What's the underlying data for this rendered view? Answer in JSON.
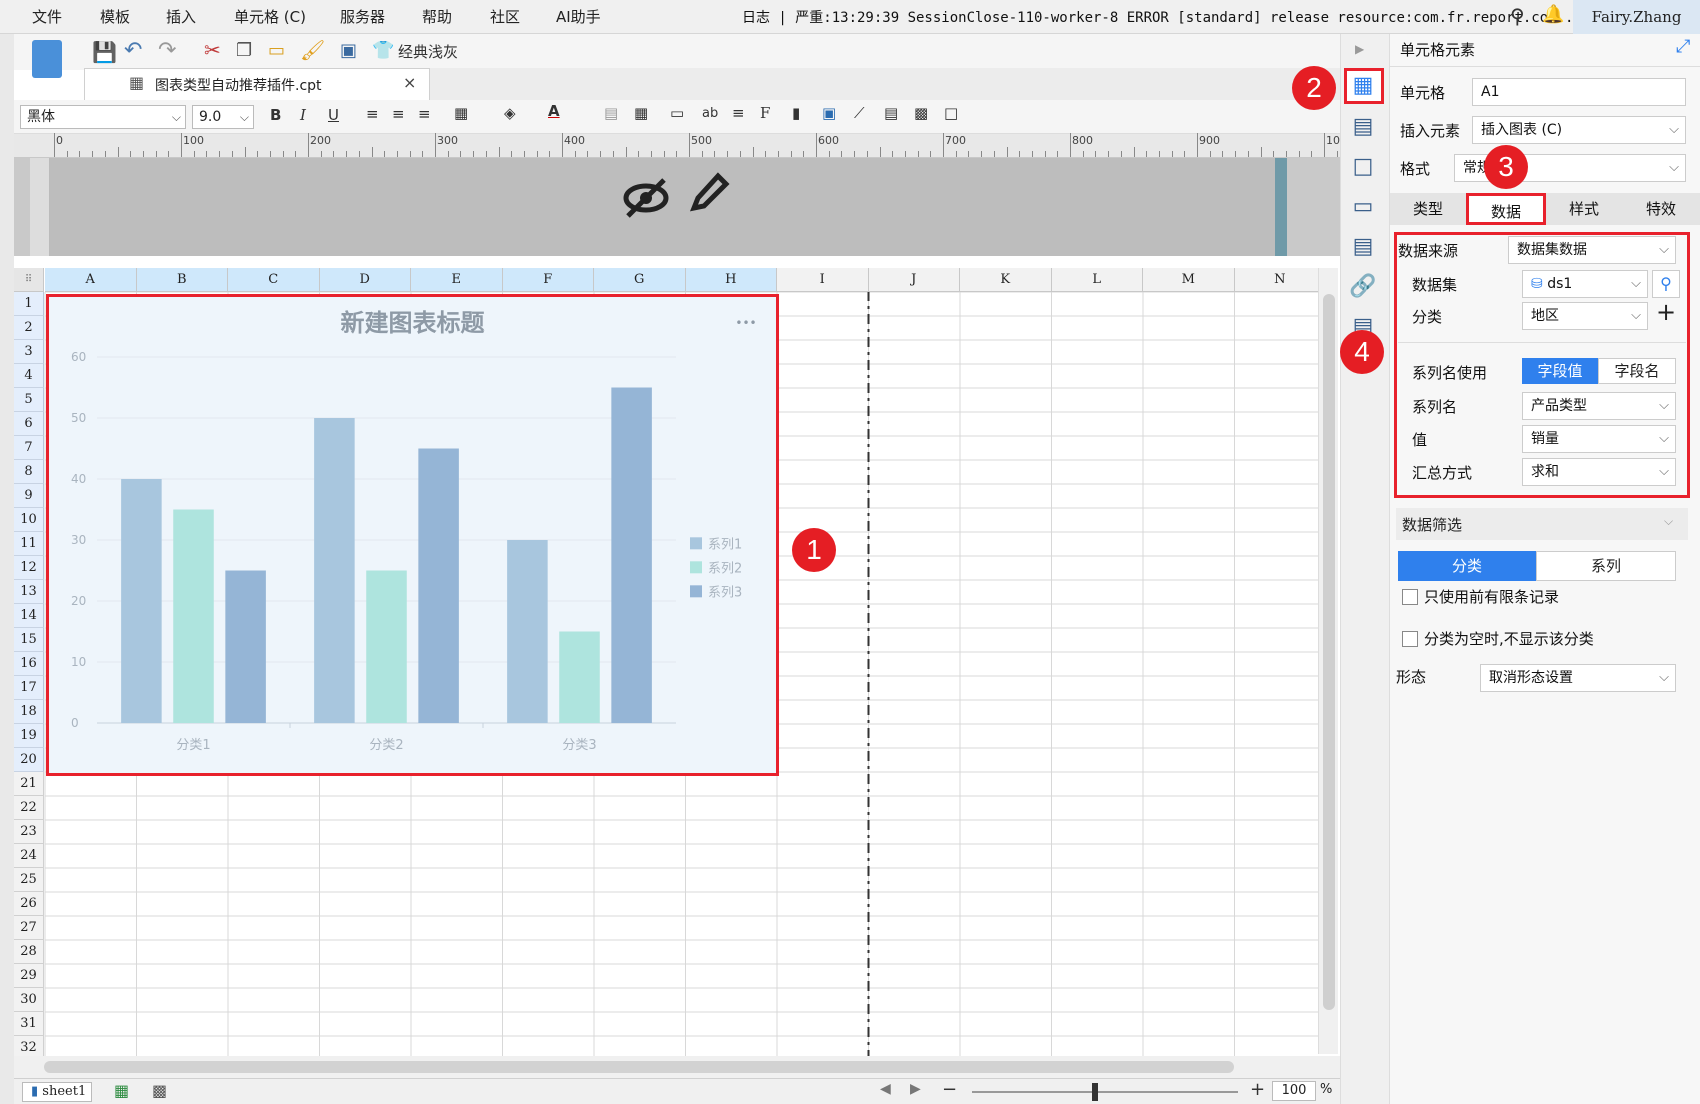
{
  "menubar": {
    "items": [
      "文件",
      "模板",
      "插入",
      "单元格 (C)",
      "服务器",
      "帮助",
      "社区",
      "AI助手"
    ],
    "log": "日志 | 严重:13:29:39 SessionClose-110-worker-8 ERROR [standard] release resource:com.fr.report.co...",
    "user": "Fairy.Zhang"
  },
  "toolbar": {
    "theme_label": "经典浅灰",
    "font": "黑体",
    "size": "9.0"
  },
  "filetab": {
    "name": "图表类型自动推荐插件.cpt",
    "close": "×"
  },
  "ruler": {
    "marks": [
      "0",
      "100",
      "200",
      "300",
      "400",
      "500",
      "600",
      "700",
      "800",
      "900",
      "10"
    ]
  },
  "grid": {
    "columns": [
      "A",
      "B",
      "C",
      "D",
      "E",
      "F",
      "G",
      "H",
      "I",
      "J",
      "K",
      "L",
      "M",
      "N"
    ],
    "rows": [
      "1",
      "2",
      "3",
      "4",
      "5",
      "6",
      "7",
      "8",
      "9",
      "10",
      "11",
      "12",
      "13",
      "14",
      "15",
      "16",
      "17",
      "18",
      "19",
      "20",
      "21",
      "22",
      "23",
      "24",
      "25",
      "26",
      "27",
      "28",
      "29",
      "30",
      "31",
      "32"
    ]
  },
  "chart_data": {
    "type": "bar",
    "title": "新建图表标题",
    "categories": [
      "分类1",
      "分类2",
      "分类3"
    ],
    "series": [
      {
        "name": "系列1",
        "values": [
          40,
          50,
          30
        ],
        "color": "#a8c6de"
      },
      {
        "name": "系列2",
        "values": [
          35,
          25,
          15
        ],
        "color": "#aee4de"
      },
      {
        "name": "系列3",
        "values": [
          25,
          45,
          55
        ],
        "color": "#95b5d6"
      }
    ],
    "ylim": [
      0,
      60
    ],
    "yticks": [
      "0",
      "10",
      "20",
      "30",
      "40",
      "50",
      "60"
    ],
    "grid": true,
    "legend": "right",
    "more": "•••"
  },
  "annotations": [
    "1",
    "2",
    "3",
    "4"
  ],
  "panel": {
    "title": "单元格元素",
    "cell_label": "单元格",
    "cell_value": "A1",
    "insert_label": "插入元素",
    "insert_value": "插入图表 (C)",
    "format_label": "格式",
    "format_value": "常规",
    "tabs": [
      "类型",
      "数据",
      "样式",
      "特效"
    ],
    "datasource_label": "数据来源",
    "datasource_value": "数据集数据",
    "dataset_label": "数据集",
    "dataset_value": "ds1",
    "category_label": "分类",
    "category_value": "地区",
    "series_use_label": "系列名使用",
    "series_use_options": [
      "字段值",
      "字段名"
    ],
    "series_name_label": "系列名",
    "series_name_value": "产品类型",
    "value_label": "值",
    "value_value": "销量",
    "agg_label": "汇总方式",
    "agg_value": "求和",
    "filter_title": "数据筛选",
    "filter_tabs": [
      "分类",
      "系列"
    ],
    "check1": "只使用前有限条记录",
    "check2": "分类为空时,不显示该分类",
    "form_label": "形态",
    "form_value": "取消形态设置"
  },
  "status": {
    "sheet": "sheet1",
    "zoom": "100",
    "percent": "%"
  },
  "colors": {
    "accent": "#2f80ed",
    "annotation": "#e51e24",
    "header_active": "#cfe8fb"
  }
}
